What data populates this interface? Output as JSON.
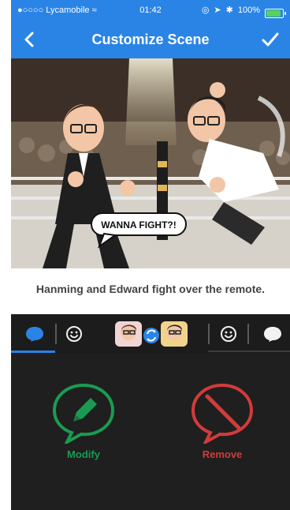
{
  "status_bar": {
    "carrier": "Lycamobile",
    "time": "01:42",
    "battery": "100%"
  },
  "nav": {
    "title": "Customize Scene"
  },
  "scene": {
    "speech_bubble": "WANNA FIGHT?!"
  },
  "caption": "Hanming and Edward fight over the remote.",
  "actions": {
    "modify_label": "Modify",
    "remove_label": "Remove"
  },
  "colors": {
    "accent": "#2a84e6",
    "modify": "#1a9b52",
    "remove": "#d23b3b",
    "dark_bg": "#1f1f1f"
  },
  "icons": {
    "back": "chevron-left-icon",
    "done": "checkmark-icon",
    "speech": "speech-bubble-icon",
    "emoji": "smiley-icon",
    "swap": "swap-icon",
    "modify": "pencil-icon",
    "remove": "no-sign-icon"
  }
}
